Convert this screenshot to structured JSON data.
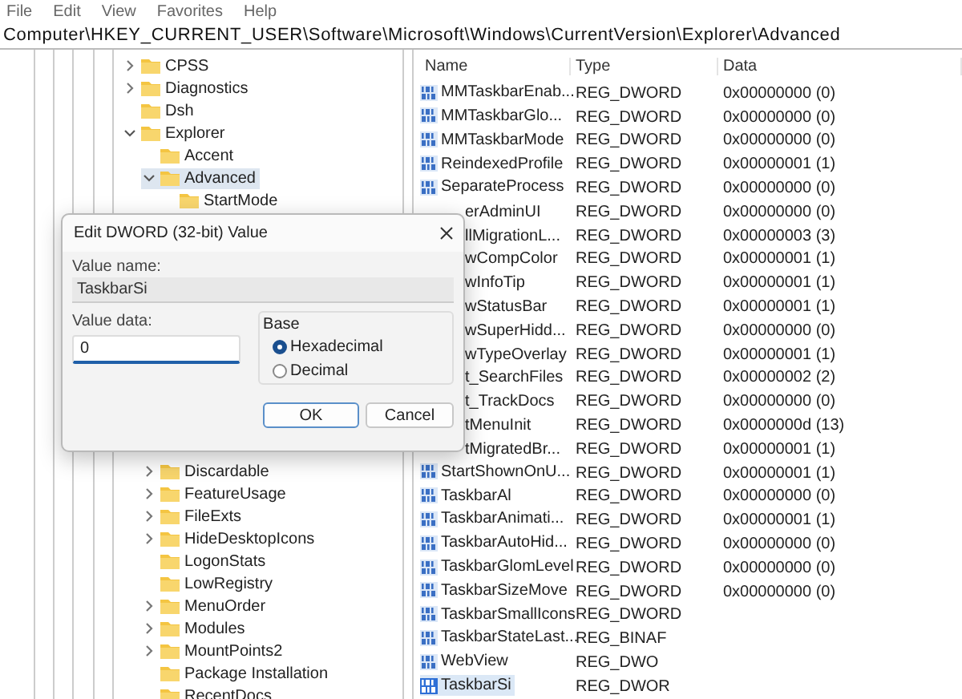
{
  "menu": [
    "File",
    "Edit",
    "View",
    "Favorites",
    "Help"
  ],
  "address": "Computer\\HKEY_CURRENT_USER\\Software\\Microsoft\\Windows\\CurrentVersion\\Explorer\\Advanced",
  "tree": [
    {
      "label": "CPSS",
      "expanded": false,
      "selected": false
    },
    {
      "label": "Diagnostics",
      "expanded": false,
      "selected": false
    },
    {
      "label": "Dsh",
      "selected": false
    },
    {
      "label": "Explorer",
      "expanded": true,
      "selected": false,
      "children": [
        {
          "label": "Accent",
          "selected": false
        },
        {
          "label": "Advanced",
          "expanded": true,
          "selected": true,
          "children": [
            {
              "label": "StartMode",
              "selected": false
            }
          ]
        },
        {
          "label": "Discardable",
          "expanded": false,
          "selected": false
        },
        {
          "label": "FeatureUsage",
          "expanded": false,
          "selected": false
        },
        {
          "label": "FileExts",
          "expanded": false,
          "selected": false
        },
        {
          "label": "HideDesktopIcons",
          "expanded": false,
          "selected": false
        },
        {
          "label": "LogonStats",
          "selected": false
        },
        {
          "label": "LowRegistry",
          "selected": false
        },
        {
          "label": "MenuOrder",
          "expanded": false,
          "selected": false
        },
        {
          "label": "Modules",
          "expanded": false,
          "selected": false
        },
        {
          "label": "MountPoints2",
          "expanded": false,
          "selected": false
        },
        {
          "label": "Package Installation",
          "selected": false
        },
        {
          "label": "RecentDocs",
          "selected": false
        }
      ]
    }
  ],
  "values": {
    "columns": [
      "Name",
      "Type",
      "Data"
    ],
    "rows": [
      {
        "kind": "full",
        "name": "MMTaskbarEnab...",
        "type": "REG_DWORD",
        "data": "0x00000000 (0)",
        "selected": false
      },
      {
        "kind": "full",
        "name": "MMTaskbarGlo...",
        "type": "REG_DWORD",
        "data": "0x00000000 (0)",
        "selected": false
      },
      {
        "kind": "full",
        "name": "MMTaskbarMode",
        "type": "REG_DWORD",
        "data": "0x00000000 (0)",
        "selected": false
      },
      {
        "kind": "full",
        "name": "ReindexedProfile",
        "type": "REG_DWORD",
        "data": "0x00000001 (1)",
        "selected": false
      },
      {
        "kind": "full",
        "name": "SeparateProcess",
        "type": "REG_DWORD",
        "data": "0x00000000 (0)",
        "selected": false
      },
      {
        "kind": "clipped",
        "name": "erAdminUI",
        "type": "REG_DWORD",
        "data": "0x00000000 (0)",
        "selected": false
      },
      {
        "kind": "clipped",
        "name": "llMigrationL...",
        "type": "REG_DWORD",
        "data": "0x00000003 (3)",
        "selected": false
      },
      {
        "kind": "clipped",
        "name": "wCompColor",
        "type": "REG_DWORD",
        "data": "0x00000001 (1)",
        "selected": false
      },
      {
        "kind": "clipped",
        "name": "wInfoTip",
        "type": "REG_DWORD",
        "data": "0x00000001 (1)",
        "selected": false
      },
      {
        "kind": "clipped",
        "name": "wStatusBar",
        "type": "REG_DWORD",
        "data": "0x00000001 (1)",
        "selected": false
      },
      {
        "kind": "clipped",
        "name": "wSuperHidd...",
        "type": "REG_DWORD",
        "data": "0x00000000 (0)",
        "selected": false
      },
      {
        "kind": "clipped",
        "name": "wTypeOverlay",
        "type": "REG_DWORD",
        "data": "0x00000001 (1)",
        "selected": false
      },
      {
        "kind": "clipped",
        "name": "t_SearchFiles",
        "type": "REG_DWORD",
        "data": "0x00000002 (2)",
        "selected": false
      },
      {
        "kind": "clipped",
        "name": "t_TrackDocs",
        "type": "REG_DWORD",
        "data": "0x00000000 (0)",
        "selected": false
      },
      {
        "kind": "clipped",
        "name": "tMenuInit",
        "type": "REG_DWORD",
        "data": "0x0000000d (13)",
        "selected": false
      },
      {
        "kind": "clipped",
        "name": "tMigratedBr...",
        "type": "REG_DWORD",
        "data": "0x00000001 (1)",
        "selected": false
      },
      {
        "kind": "full",
        "name": "StartShownOnU...",
        "type": "REG_DWORD",
        "data": "0x00000001 (1)",
        "selected": false
      },
      {
        "kind": "full",
        "name": "TaskbarAl",
        "type": "REG_DWORD",
        "data": "0x00000000 (0)",
        "selected": false
      },
      {
        "kind": "full",
        "name": "TaskbarAnimati...",
        "type": "REG_DWORD",
        "data": "0x00000001 (1)",
        "selected": false
      },
      {
        "kind": "full",
        "name": "TaskbarAutoHid...",
        "type": "REG_DWORD",
        "data": "0x00000000 (0)",
        "selected": false
      },
      {
        "kind": "full",
        "name": "TaskbarGlomLevel",
        "type": "REG_DWORD",
        "data": "0x00000000 (0)",
        "selected": false
      },
      {
        "kind": "full",
        "name": "TaskbarSizeMove",
        "type": "REG_DWORD",
        "data": "0x00000000 (0)",
        "selected": false
      },
      {
        "kind": "full",
        "name": "TaskbarSmallIcons",
        "type": "REG_DWORD",
        "selected": false
      },
      {
        "kind": "full",
        "name": "TaskbarStateLast...",
        "type": "REG_BINAF",
        "selected": false
      },
      {
        "kind": "full",
        "name": "WebView",
        "type": "REG_DWO",
        "selected": false
      },
      {
        "kind": "full",
        "name": "TaskbarSi",
        "type": "REG_DWOR",
        "selected": true
      }
    ]
  },
  "dialog": {
    "title": "Edit DWORD (32-bit) Value",
    "value_name_label": "Value name:",
    "value_name": "TaskbarSi",
    "value_data_label": "Value data:",
    "value_data": "0",
    "base_label": "Base",
    "base_options": [
      {
        "label": "Hexadecimal",
        "selected": true
      },
      {
        "label": "Decimal",
        "selected": false
      }
    ],
    "buttons": [
      {
        "label": "OK",
        "default": true
      },
      {
        "label": "Cancel",
        "default": false
      }
    ]
  }
}
